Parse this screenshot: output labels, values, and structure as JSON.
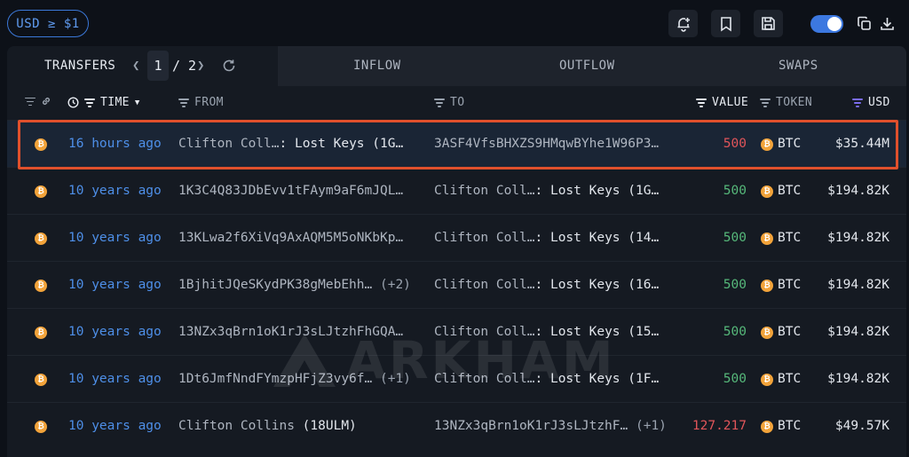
{
  "filter_pill": "USD ≥ $1",
  "tabs": {
    "transfers": "TRANSFERS",
    "page_current": "1",
    "page_total": "/ 2",
    "inflow": "INFLOW",
    "outflow": "OUTFLOW",
    "swaps": "SWAPS"
  },
  "columns": {
    "time": "TIME",
    "from": "FROM",
    "to": "TO",
    "value": "VALUE",
    "token": "TOKEN",
    "usd": "USD"
  },
  "watermark": "ARKHAM",
  "colors": {
    "accent": "#3b78d8",
    "highlight": "#e0502c",
    "btc": "#f2a33a",
    "value_red": "#e0555a",
    "value_green": "#56b87a"
  },
  "rows": [
    {
      "time": "16 hours ago",
      "from_name": "Clifton Coll…",
      "from_label": ": Lost Keys (1G…",
      "from_extra": "",
      "to_name": "3ASF4VfsBHXZS9HMqwBYhe1W96P3…",
      "to_label": "",
      "to_extra": "",
      "value": "500",
      "value_color": "red",
      "token": "BTC",
      "usd": "$35.44M",
      "highlighted": true
    },
    {
      "time": "10 years ago",
      "from_name": "1K3C4Q83JDbEvv1tFAym9aF6mJQL…",
      "from_label": "",
      "from_extra": "",
      "to_name": "Clifton Coll…",
      "to_label": ": Lost Keys (1G…",
      "to_extra": "",
      "value": "500",
      "value_color": "green",
      "token": "BTC",
      "usd": "$194.82K"
    },
    {
      "time": "10 years ago",
      "from_name": "13KLwa2f6XiVq9AxAQM5M5oNKbKp…",
      "from_label": "",
      "from_extra": "",
      "to_name": "Clifton Coll…",
      "to_label": ": Lost Keys (14…",
      "to_extra": "",
      "value": "500",
      "value_color": "green",
      "token": "BTC",
      "usd": "$194.82K"
    },
    {
      "time": "10 years ago",
      "from_name": "1BjhitJQeSKydPK38gMebEhh…",
      "from_label": "",
      "from_extra": "(+2)",
      "to_name": "Clifton Coll…",
      "to_label": ": Lost Keys (16…",
      "to_extra": "",
      "value": "500",
      "value_color": "green",
      "token": "BTC",
      "usd": "$194.82K"
    },
    {
      "time": "10 years ago",
      "from_name": "13NZx3qBrn1oK1rJ3sLJtzhFhGQA…",
      "from_label": "",
      "from_extra": "",
      "to_name": "Clifton Coll…",
      "to_label": ": Lost Keys (15…",
      "to_extra": "",
      "value": "500",
      "value_color": "green",
      "token": "BTC",
      "usd": "$194.82K"
    },
    {
      "time": "10 years ago",
      "from_name": "1Dt6JmfNndFYmzpHFjZ3vy6f…",
      "from_label": "",
      "from_extra": "(+1)",
      "to_name": "Clifton Coll…",
      "to_label": ": Lost Keys (1F…",
      "to_extra": "",
      "value": "500",
      "value_color": "green",
      "token": "BTC",
      "usd": "$194.82K"
    },
    {
      "time": "10 years ago",
      "from_name": "Clifton Collins",
      "from_label": " (18ULM)",
      "from_extra": "",
      "to_name": "13NZx3qBrn1oK1rJ3sLJtzhF…",
      "to_label": "",
      "to_extra": "(+1)",
      "value": "127.217",
      "value_color": "red",
      "token": "BTC",
      "usd": "$49.57K"
    }
  ]
}
